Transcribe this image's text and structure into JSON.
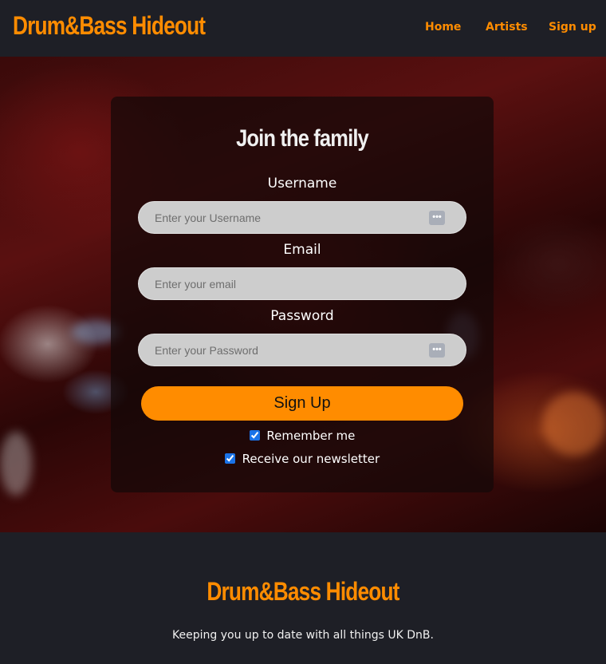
{
  "header": {
    "brand": "Drum&Bass Hideout",
    "nav": {
      "home": "Home",
      "artists": "Artists",
      "signup": "Sign up"
    }
  },
  "form": {
    "title": "Join the family",
    "username_label": "Username",
    "username_placeholder": "Enter your Username",
    "email_label": "Email",
    "email_placeholder": "Enter your email",
    "password_label": "Password",
    "password_placeholder": "Enter your Password",
    "submit_label": "Sign Up",
    "remember_label": "Remember me",
    "remember_checked": true,
    "newsletter_label": "Receive our newsletter",
    "newsletter_checked": true,
    "password_manager_icon": "password-manager-icon"
  },
  "footer": {
    "brand": "Drum&Bass Hideout",
    "tagline": "Keeping you up to date with all things UK DnB."
  },
  "colors": {
    "accent": "#ff8c00",
    "background": "#1e1f26",
    "field": "#cdcdcd"
  }
}
